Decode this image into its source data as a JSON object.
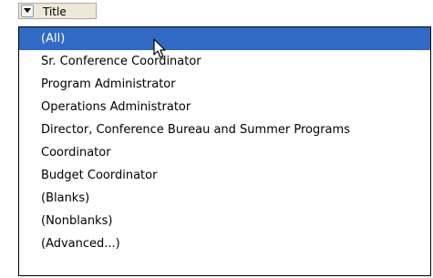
{
  "header": {
    "label": "Title",
    "filter_icon": "dropdown-arrow-icon"
  },
  "dropdown": {
    "selected_index": 0,
    "items": [
      {
        "label": "(All)"
      },
      {
        "label": "Sr. Conference Coordinator"
      },
      {
        "label": "Program Administrator"
      },
      {
        "label": "Operations Administrator"
      },
      {
        "label": "Director, Conference Bureau and Summer Programs"
      },
      {
        "label": "Coordinator"
      },
      {
        "label": "Budget Coordinator"
      },
      {
        "label": "(Blanks)"
      },
      {
        "label": "(Nonblanks)"
      },
      {
        "label": "(Advanced...)"
      }
    ]
  },
  "colors": {
    "selection": "#316ac5",
    "header_bg": "#ece9d8"
  }
}
